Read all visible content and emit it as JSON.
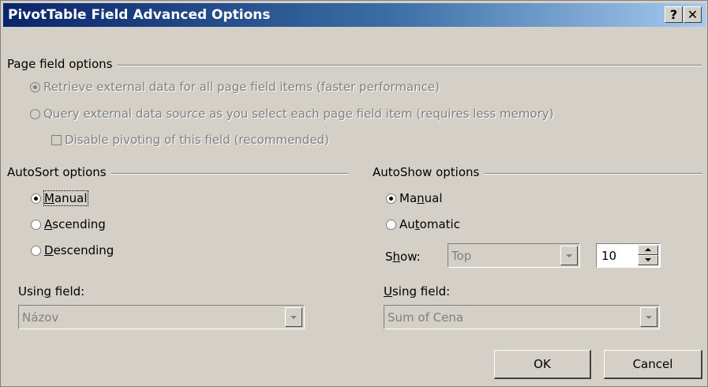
{
  "window": {
    "title": "PivotTable Field Advanced Options",
    "help_label": "?",
    "close_label": "✕"
  },
  "page_field": {
    "group_label": "Page field options",
    "retrieve_label": "Retrieve external data for all page field items (faster performance)",
    "query_label": "Query external data source as you select each page field item (requires less memory)",
    "disable_label": "Disable pivoting of this field (recommended)"
  },
  "autosort": {
    "group_label": "AutoSort options",
    "manual": {
      "pre": "",
      "u": "M",
      "post": "anual"
    },
    "ascending": {
      "pre": "",
      "u": "A",
      "post": "scending"
    },
    "descending": {
      "pre": "",
      "u": "D",
      "post": "escending"
    },
    "using_field": {
      "pre": "Usin",
      "u": "g",
      "post": " field:"
    },
    "using_field_value": "Názov"
  },
  "autoshow": {
    "group_label": "AutoShow options",
    "manual": {
      "pre": "Ma",
      "u": "n",
      "post": "ual"
    },
    "automatic": {
      "pre": "Au",
      "u": "t",
      "post": "omatic"
    },
    "show": {
      "pre": "S",
      "u": "h",
      "post": "ow:"
    },
    "show_value": "Top",
    "count_value": "10",
    "using_field": {
      "pre": "",
      "u": "U",
      "post": "sing field:"
    },
    "using_field_value": "Sum of Cena"
  },
  "buttons": {
    "ok": "OK",
    "cancel": "Cancel"
  }
}
